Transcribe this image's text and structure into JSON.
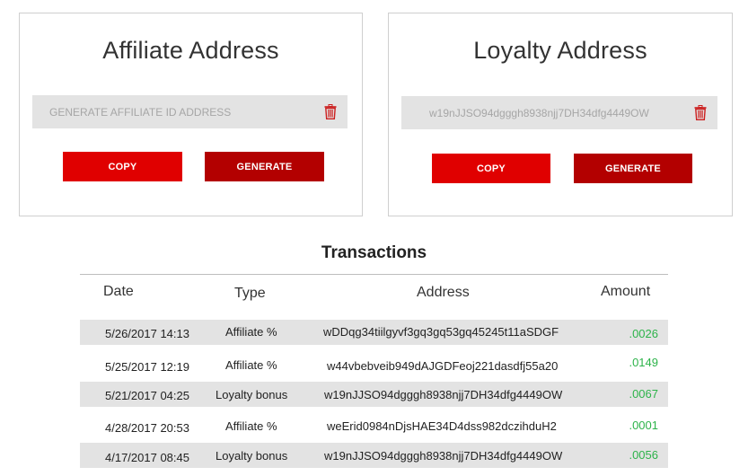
{
  "affiliate": {
    "title": "Affiliate Address",
    "address_placeholder": "GENERATE AFFILIATE ID ADDRESS",
    "copy_label": "COPY",
    "generate_label": "GENERATE"
  },
  "loyalty": {
    "title": "Loyalty Address",
    "address_value": "w19nJJSO94dgggh8938njj7DH34dfg4449OW",
    "copy_label": "COPY",
    "generate_label": "GENERATE"
  },
  "transactions": {
    "title": "Transactions",
    "columns": {
      "date": "Date",
      "type": "Type",
      "address": "Address",
      "amount": "Amount"
    },
    "rows": [
      {
        "date": "5/26/2017 14:13",
        "type": "Affiliate %",
        "address": "wDDqg34tiilgyvf3gq3gq53gq45245t11aSDGF",
        "amount": ".0026"
      },
      {
        "date": "5/25/2017 12:19",
        "type": "Affiliate %",
        "address": "w44vbebveib949dAJGDFeoj221dasdfj55a20",
        "amount": ".0149"
      },
      {
        "date": "5/21/2017 04:25",
        "type": "Loyalty bonus",
        "address": "w19nJJSO94dgggh8938njj7DH34dfg4449OW",
        "amount": ".0067"
      },
      {
        "date": "4/28/2017 20:53",
        "type": "Affiliate %",
        "address": "weErid0984nDjsHAE34D4dss982dczihduH2",
        "amount": ".0001"
      },
      {
        "date": "4/17/2017 08:45",
        "type": "Loyalty bonus",
        "address": "w19nJJSO94dgggh8938njj7DH34dfg4449OW",
        "amount": ".0056"
      }
    ]
  },
  "colors": {
    "copy_button": "#e00000",
    "generate_button": "#b30000",
    "amount_text": "#2db34a",
    "trash_icon": "#cc1f1f"
  },
  "icons": {
    "delete": "trash-icon"
  }
}
